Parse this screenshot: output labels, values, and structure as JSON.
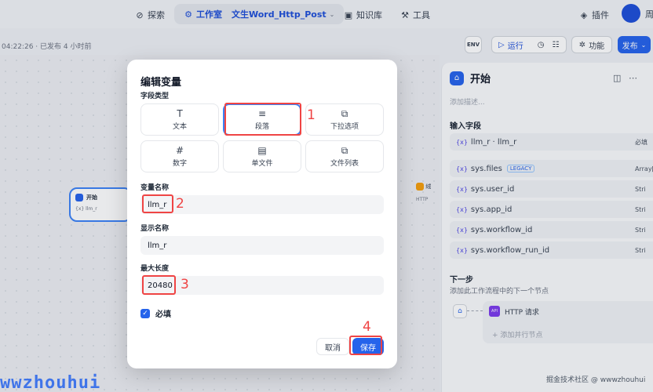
{
  "topbar": {
    "search_label": "探索",
    "studio_label": "工作室",
    "app_name": "文生Word_Http_Post",
    "knowledge_label": "知识库",
    "tools_label": "工具",
    "plugins_label": "插件",
    "user_name": "周"
  },
  "toolbar": {
    "publish_info": "04:22:26 · 已发布 4 小时前",
    "env_label": "ENV",
    "run_label": "运行",
    "features_label": "功能",
    "publish_label": "发布"
  },
  "canvas": {
    "start_node_title": "开始",
    "start_node_var": "{x} llm_r",
    "right_node_title": "绒",
    "right_node_sub": "HTTP"
  },
  "panel": {
    "title": "开始",
    "description_placeholder": "添加描述...",
    "input_fields_label": "输入字段",
    "fields": [
      {
        "name": "llm_r · llm_r",
        "right": "必填",
        "badge": ""
      },
      {
        "name": "sys.files",
        "right": "Array[Fi",
        "badge": "LEGACY"
      },
      {
        "name": "sys.user_id",
        "right": "Stri",
        "badge": ""
      },
      {
        "name": "sys.app_id",
        "right": "Stri",
        "badge": ""
      },
      {
        "name": "sys.workflow_id",
        "right": "Stri",
        "badge": ""
      },
      {
        "name": "sys.workflow_run_id",
        "right": "Stri",
        "badge": ""
      }
    ],
    "var_prefix": "{x}",
    "next_step_label": "下一步",
    "next_step_desc": "添加此工作流程中的下一个节点",
    "next_node_label": "HTTP 请求",
    "add_parallel_label": "+ 添加并行节点"
  },
  "modal": {
    "title": "编辑变量",
    "field_type_label": "字段类型",
    "types": [
      {
        "label": "文本",
        "icon": "T"
      },
      {
        "label": "段落",
        "icon": "≡"
      },
      {
        "label": "下拉选项",
        "icon": "⧉"
      },
      {
        "label": "数字",
        "icon": "#"
      },
      {
        "label": "单文件",
        "icon": "▤"
      },
      {
        "label": "文件列表",
        "icon": "⧉"
      }
    ],
    "selected_type": "段落",
    "var_name_label": "变量名称",
    "var_name_value": "llm_r",
    "display_name_label": "显示名称",
    "display_name_value": "llm_r",
    "max_length_label": "最大长度",
    "max_length_value": "20480",
    "required_label": "必填",
    "required_checked": true,
    "cancel_label": "取消",
    "save_label": "保存"
  },
  "annotations": [
    "1",
    "2",
    "3",
    "4"
  ],
  "watermarks": {
    "left": "wwzhouhui",
    "right": "掘金技术社区 @ wwwzhouhui"
  },
  "colors": {
    "accent": "#2563eb",
    "annotation": "#ef4444"
  }
}
